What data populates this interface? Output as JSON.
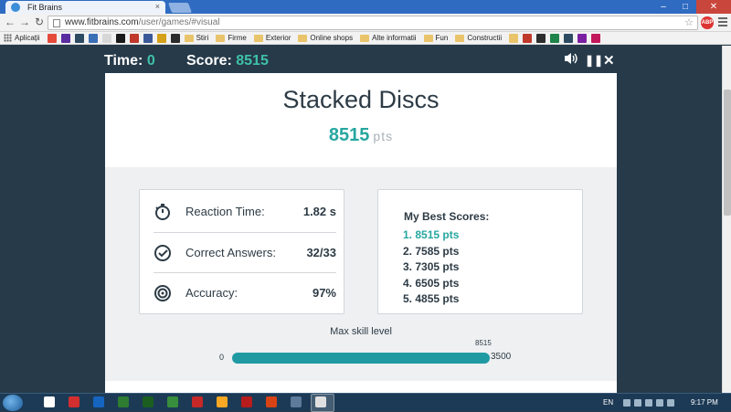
{
  "browser": {
    "tab_title": "Fit Brains",
    "tab_close": "×",
    "url_domain": "www.fitbrains.com",
    "url_path": "/user/games/#visual",
    "adblock_label": "ABP",
    "window_buttons": {
      "minimize": "–",
      "maximize": "□",
      "close": "✕"
    },
    "nav": {
      "back": "←",
      "forward": "→",
      "reload": "↻"
    },
    "star": "☆",
    "bookmarks": [
      {
        "label": "Aplicații",
        "type": "apps"
      },
      {
        "label": "Stiri",
        "type": "folder"
      },
      {
        "label": "Firme",
        "type": "folder"
      },
      {
        "label": "Exterior",
        "type": "folder"
      },
      {
        "label": "Online shops",
        "type": "folder"
      },
      {
        "label": "Alte informatii",
        "type": "folder"
      },
      {
        "label": "Fun",
        "type": "folder"
      },
      {
        "label": "Constructii",
        "type": "folder"
      }
    ],
    "bookmark_icon_colors": [
      "#e64a3b",
      "#5a2ca0",
      "#2d4a63",
      "#3b6fb6",
      "#d7d7d7",
      "#1a1a1a",
      "#c0392b",
      "#3b5998",
      "#d4a017",
      "#2b2b2b"
    ],
    "bookmark_icon_colors_right": [
      "#e9c46a",
      "#c0392b",
      "#2d2d2d",
      "#1e8449",
      "#2d4a63",
      "#7b1fa2",
      "#c2185b"
    ]
  },
  "game_bar": {
    "time_label": "Time:",
    "time_value": "0",
    "score_label": "Score:",
    "score_value": "8515",
    "controls": {
      "sound": "🔊",
      "pause": "❚❚",
      "close": "✕"
    }
  },
  "result": {
    "title": "Stacked Discs",
    "score": "8515",
    "score_unit": "pts",
    "stats": [
      {
        "label": "Reaction Time:",
        "value": "1.82 s",
        "icon": "stopwatch-icon"
      },
      {
        "label": "Correct Answers:",
        "value": "32/33",
        "icon": "checkmark-icon"
      },
      {
        "label": "Accuracy:",
        "value": "97%",
        "icon": "target-icon"
      }
    ],
    "best_scores_title": "My Best Scores:",
    "best_scores": [
      "1. 8515 pts",
      "2. 7585 pts",
      "3. 7305 pts",
      "4. 6505 pts",
      "5. 4855 pts"
    ],
    "skill": {
      "label": "Max skill level",
      "min": "0",
      "max": "3500",
      "marker": "8515",
      "fill_fraction": 1.0
    }
  },
  "taskbar": {
    "language": "EN",
    "clock": "9:17 PM",
    "item_colors": [
      "#ffffff",
      "#d32f2f",
      "#1565c0",
      "#2e7d32",
      "#1b5e20",
      "#388e3c",
      "#c62828",
      "#f9a825",
      "#b71c1c",
      "#d84315",
      "#5d7b9a",
      "#e0e0e0"
    ]
  },
  "colors": {
    "accent": "#26a6a0",
    "page_bg": "#263a4a",
    "skill_fill": "#1f9aa3"
  }
}
